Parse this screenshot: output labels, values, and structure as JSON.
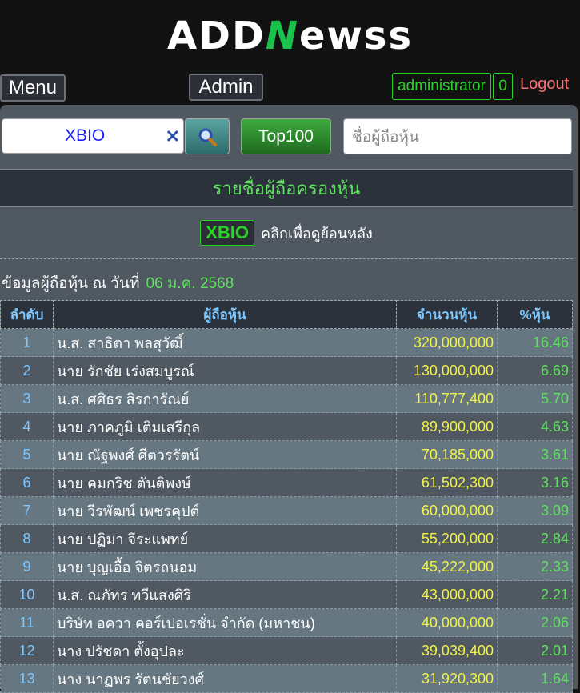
{
  "logo": {
    "part1": "ADD",
    "part2": "N",
    "part3": "ewss"
  },
  "topbar": {
    "menu_label": "Menu",
    "admin_label": "Admin",
    "user_name": "administrator",
    "user_count": "0",
    "logout_label": "Logout"
  },
  "search": {
    "value": "XBIO",
    "clear_glyph": "✕",
    "top100_label": "Top100",
    "holder_placeholder": "ชื่อผู้ถือหุ้น"
  },
  "section_title": "รายชื่อผู้ถือครองหุ้น",
  "back": {
    "ticker": "XBIO",
    "text": "คลิกเพื่อดูย้อนหลัง"
  },
  "info": {
    "label": "ข้อมูลผู้ถือหุ้น ณ วันที่",
    "date": "06 ม.ค. 2568"
  },
  "table": {
    "headers": {
      "rank": "ลำดับ",
      "holder": "ผู้ถือหุ้น",
      "shares": "จำนวนหุ้น",
      "pct": "%หุ้น"
    },
    "rows": [
      {
        "rank": "1",
        "name": "น.ส. สาธิตา พลสุวัฒิ์",
        "shares": "320,000,000",
        "pct": "16.46"
      },
      {
        "rank": "2",
        "name": "นาย รักชัย เร่งสมบูรณ์",
        "shares": "130,000,000",
        "pct": "6.69"
      },
      {
        "rank": "3",
        "name": "น.ส. ศศิธร สิรการัณย์",
        "shares": "110,777,400",
        "pct": "5.70"
      },
      {
        "rank": "4",
        "name": "นาย ภาคภูมิ เติมเสรีกุล",
        "shares": "89,900,000",
        "pct": "4.63"
      },
      {
        "rank": "5",
        "name": "นาย ณัฐพงศ์ ศีตวรรัตน์",
        "shares": "70,185,000",
        "pct": "3.61"
      },
      {
        "rank": "6",
        "name": "นาย คมกริช ตันติพงษ์",
        "shares": "61,502,300",
        "pct": "3.16"
      },
      {
        "rank": "7",
        "name": "นาย วีรพัฒน์ เพชรคุปต์",
        "shares": "60,000,000",
        "pct": "3.09"
      },
      {
        "rank": "8",
        "name": "นาย ปฏิมา จีระแพทย์",
        "shares": "55,200,000",
        "pct": "2.84"
      },
      {
        "rank": "9",
        "name": "นาย บุญเอื้อ จิตรถนอม",
        "shares": "45,222,000",
        "pct": "2.33"
      },
      {
        "rank": "10",
        "name": "น.ส. ณภัทร ทวีแสงศิริ",
        "shares": "43,000,000",
        "pct": "2.21"
      },
      {
        "rank": "11",
        "name": "บริษัท อควา คอร์เปอเรชั่น จำกัด (มหาชน)",
        "shares": "40,000,000",
        "pct": "2.06"
      },
      {
        "rank": "12",
        "name": "นาง ปรัชดา ตั้งอุปละ",
        "shares": "39,039,400",
        "pct": "2.01"
      },
      {
        "rank": "13",
        "name": "นาง นาฏพร รัตนชัยวงศ์",
        "shares": "31,920,300",
        "pct": "1.64"
      }
    ]
  }
}
